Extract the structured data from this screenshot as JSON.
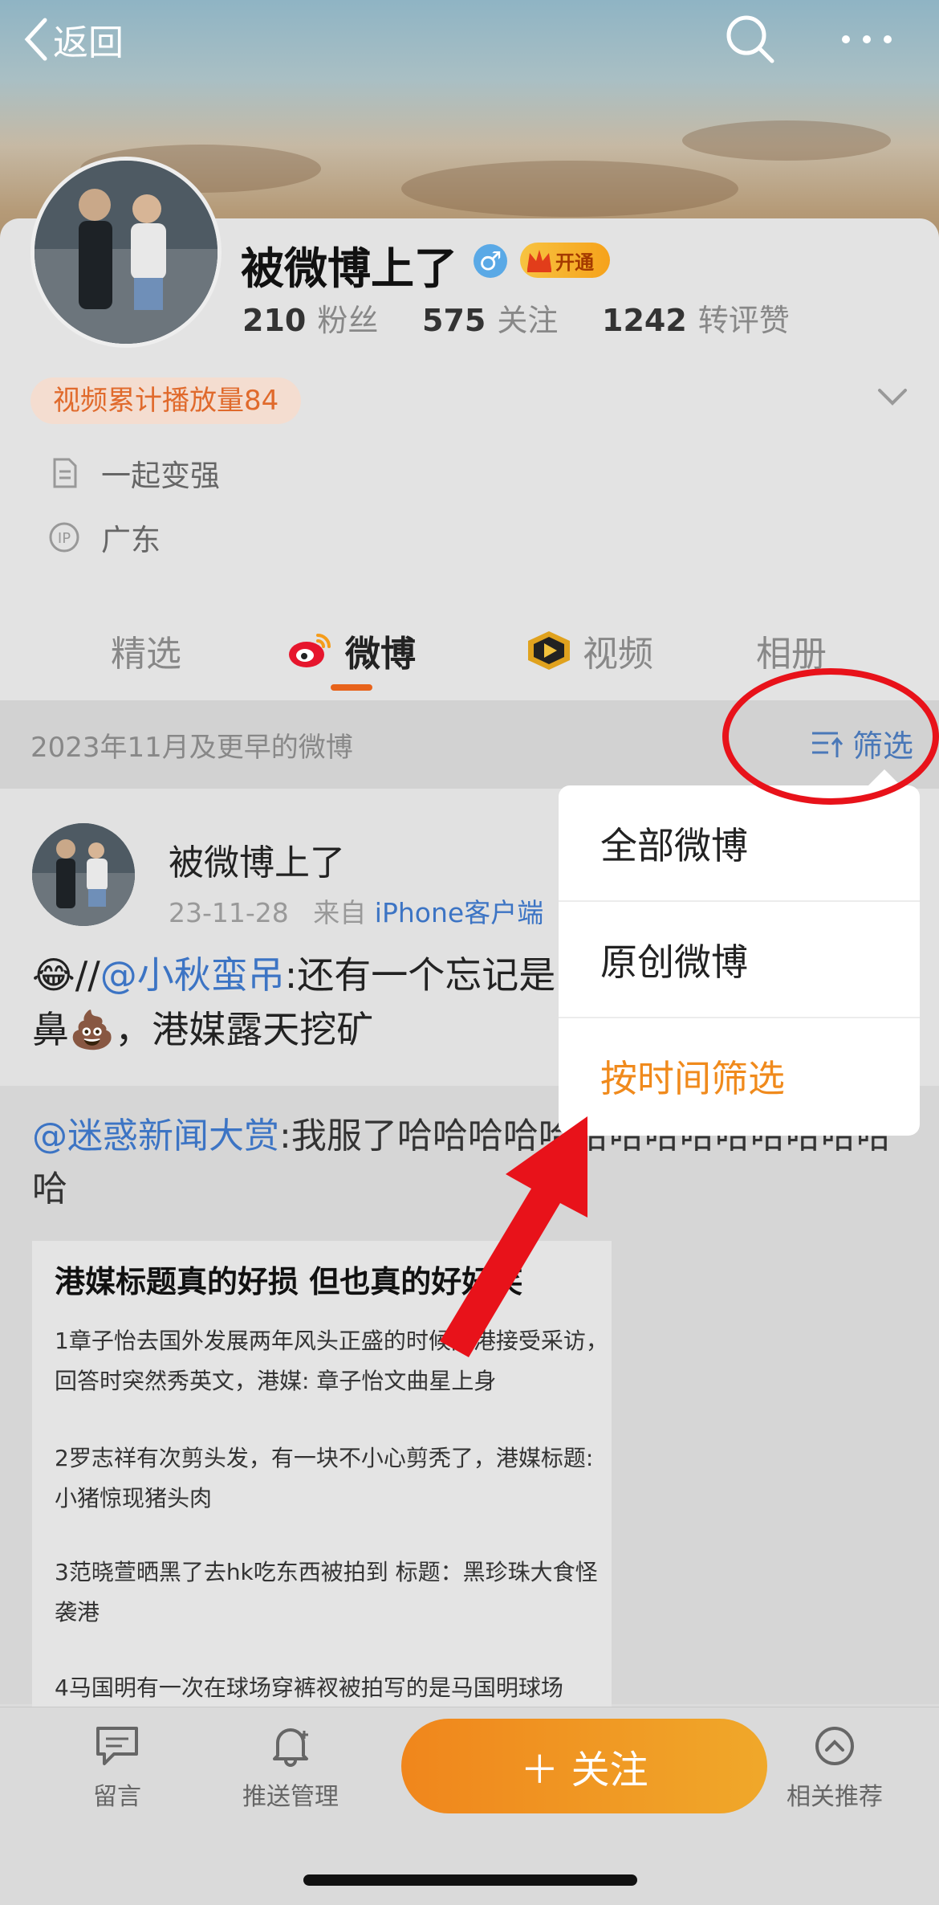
{
  "header": {
    "back_label": "返回"
  },
  "profile": {
    "name": "被微博上了",
    "vip_label": "开通",
    "stats": [
      {
        "value": "210",
        "label": "粉丝"
      },
      {
        "value": "575",
        "label": "关注"
      },
      {
        "value": "1242",
        "label": "转评赞"
      }
    ],
    "video_badge": "视频累计播放量84",
    "bio": "一起变强",
    "ip_location": "广东"
  },
  "tabs": [
    {
      "label": "精选"
    },
    {
      "label": "微博"
    },
    {
      "label": "视频"
    },
    {
      "label": "相册"
    }
  ],
  "filter_bar": {
    "date_text": "2023年11月及更早的微博",
    "filter_label": "筛选"
  },
  "post": {
    "author": "被微博上了",
    "date": "23-11-28",
    "source_prefix": "来自",
    "source": "iPhone客户端",
    "text_emoji": "😂",
    "text_slash": "//",
    "mention": "@小秋蛮吊",
    "text_line1": ":还有一个忘记是",
    "text_line2": "鼻💩，港媒露天挖矿"
  },
  "repost": {
    "mention": "@迷惑新闻大赏",
    "text": ":我服了哈哈哈哈哈哈哈哈哈哈哈哈哈哈哈",
    "article_title": "港媒标题真的好损 但也真的好好笑",
    "paragraphs": [
      "1章子怡去国外发展两年风头正盛的时候回港接受采访，回答时突然秀英文，港媒: 章子怡文曲星上身",
      "2罗志祥有次剪头发，有一块不小心剪秃了，港媒标题:小猪惊现猪头肉",
      "3范晓萱晒黑了去hk吃东西被拍到 标题：黑珍珠大食怪袭港",
      "4马国明有一次在球场穿裤衩被拍写的是马国明球场"
    ]
  },
  "dropdown": {
    "items": [
      {
        "label": "全部微博"
      },
      {
        "label": "原创微博"
      },
      {
        "label": "按时间筛选"
      }
    ],
    "highlight_color": "#f08a1c"
  },
  "bottom_bar": {
    "comment_label": "留言",
    "push_label": "推送管理",
    "follow_label": "＋ 关注",
    "recommend_label": "相关推荐"
  },
  "colors": {
    "accent": "#e8631b",
    "link": "#3c74c4",
    "annotation": "#e8121a"
  }
}
